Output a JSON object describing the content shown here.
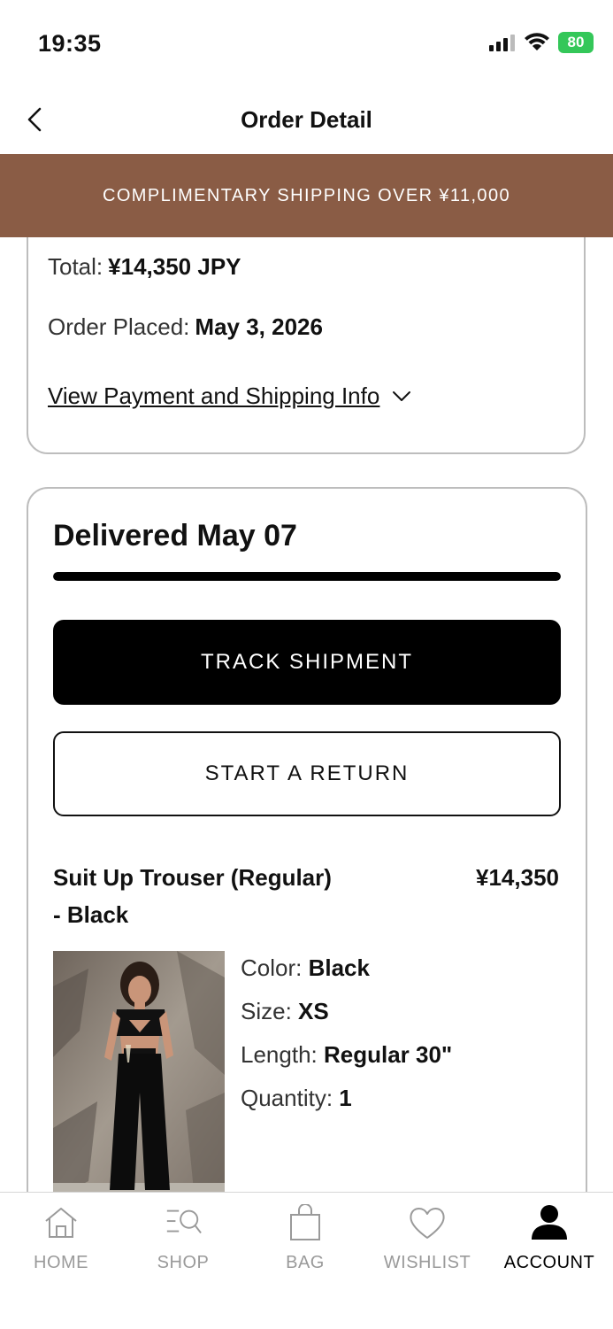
{
  "status_bar": {
    "time": "19:35",
    "battery": "80"
  },
  "header": {
    "title": "Order Detail"
  },
  "promo": {
    "text": "COMPLIMENTARY SHIPPING OVER ¥11,000"
  },
  "summary": {
    "total_label": "Total:",
    "total_value": "¥14,350 JPY",
    "placed_label": "Order Placed:",
    "placed_value": "May 3, 2026",
    "view_link": "View Payment and Shipping Info"
  },
  "shipment": {
    "status": "Delivered May 07",
    "progress": 1.0,
    "track_label": "TRACK SHIPMENT",
    "return_label": "START A RETURN"
  },
  "item": {
    "name_line1": "Suit Up Trouser (Regular)",
    "name_line2": "- Black",
    "price": "¥14,350",
    "attributes": [
      {
        "label": "Color:",
        "value": "Black"
      },
      {
        "label": "Size:",
        "value": "XS"
      },
      {
        "label": "Length:",
        "value": "Regular 30\""
      },
      {
        "label": "Quantity:",
        "value": "1"
      }
    ]
  },
  "tabbar": {
    "items": [
      {
        "label": "HOME",
        "icon": "home-icon"
      },
      {
        "label": "SHOP",
        "icon": "shop-icon"
      },
      {
        "label": "BAG",
        "icon": "bag-icon"
      },
      {
        "label": "WISHLIST",
        "icon": "heart-icon"
      },
      {
        "label": "ACCOUNT",
        "icon": "account-icon"
      }
    ],
    "active_index": 4
  },
  "colors": {
    "banner": "#8a5c45",
    "battery": "#34c759",
    "primary": "#000000"
  }
}
